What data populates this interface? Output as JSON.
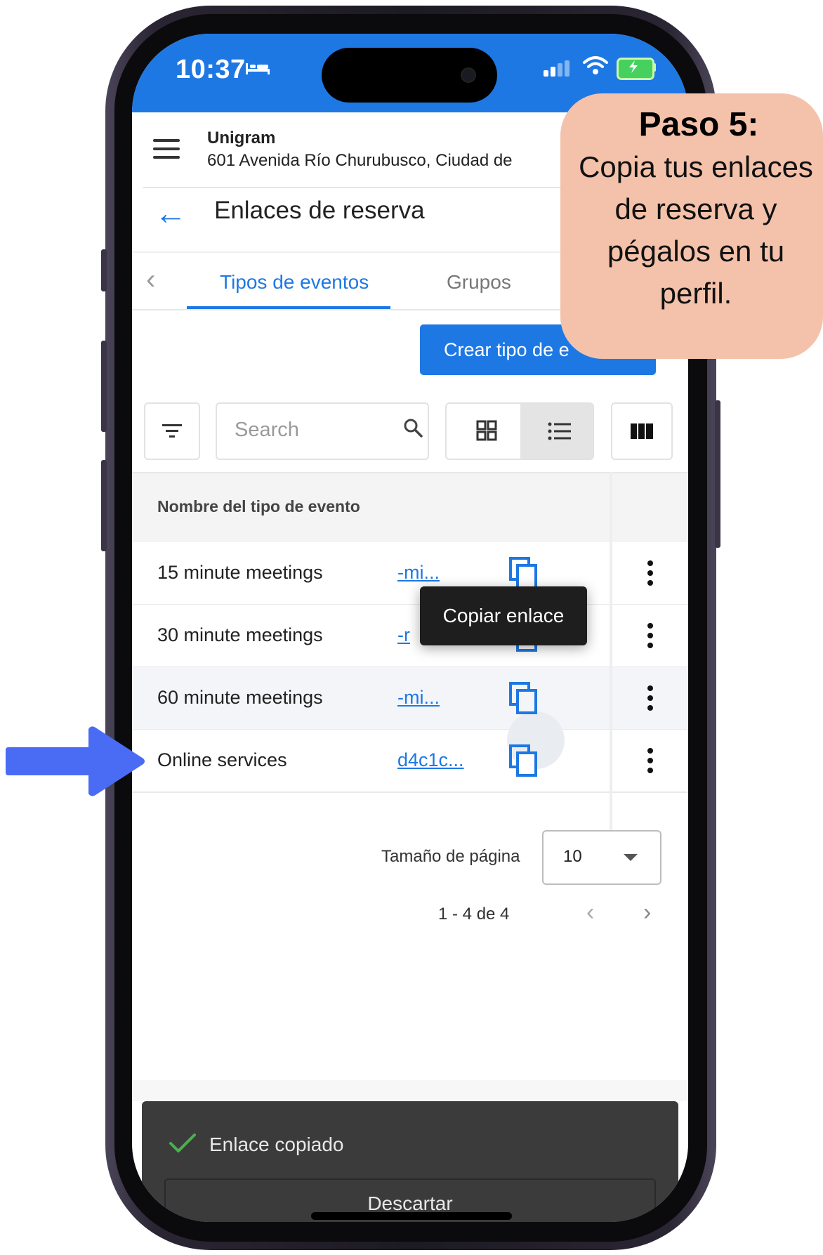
{
  "status_bar": {
    "time": "10:37"
  },
  "header": {
    "business_name": "Unigram",
    "address": "601 Avenida Río Churubusco, Ciudad de M"
  },
  "page": {
    "title": "Enlaces de reserva"
  },
  "tabs": [
    {
      "label": "Tipos de eventos",
      "active": true
    },
    {
      "label": "Grupos",
      "active": false
    }
  ],
  "create_button": {
    "label": "Crear tipo de e"
  },
  "toolbar": {
    "search_placeholder": "Search"
  },
  "table": {
    "column_header": "Nombre del tipo de evento",
    "rows": [
      {
        "name": "15 minute meetings",
        "link": "-mi..."
      },
      {
        "name": "30 minute meetings",
        "link": "-r"
      },
      {
        "name": "60 minute meetings",
        "link": "-mi..."
      },
      {
        "name": "Online services",
        "link": "d4c1c..."
      }
    ]
  },
  "tooltip": {
    "text": "Copiar enlace"
  },
  "pagination": {
    "page_size_label": "Tamaño de página",
    "page_size": "10",
    "range": "1 - 4 de 4"
  },
  "snackbar": {
    "message": "Enlace copiado",
    "dismiss_label": "Descartar"
  },
  "callout": {
    "title": "Paso 5:",
    "body": "Copia tus enlaces de reserva y pégalos en tu perfil."
  },
  "colors": {
    "accent": "#1e78e4",
    "callout_bg": "#f4c2aa",
    "arrow": "#4a6cf5",
    "snackbar_bg": "#3b3b3b",
    "success": "#4caf50"
  }
}
